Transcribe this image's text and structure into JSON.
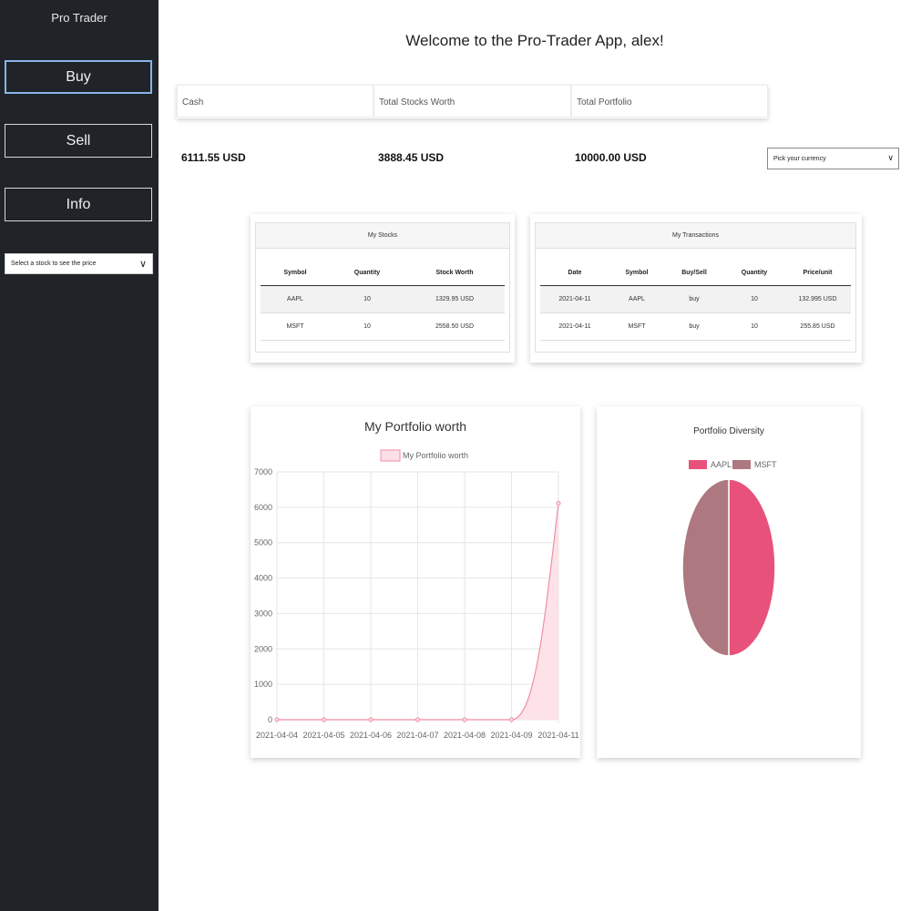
{
  "sidebar": {
    "brand": "Pro Trader",
    "buttons": [
      {
        "label": "Buy"
      },
      {
        "label": "Sell"
      },
      {
        "label": "Info"
      }
    ],
    "stock_select": {
      "value": "Select a stock to see the price"
    }
  },
  "header": {
    "title": "Welcome to the Pro-Trader App, alex!"
  },
  "summary": {
    "cash_label": "Cash",
    "stocks_label": "Total Stocks Worth",
    "portfolio_label": "Total Portfolio",
    "cash_value": "6111.55 USD",
    "stocks_value": "3888.45 USD",
    "portfolio_value": "10000.00 USD"
  },
  "currency_select": {
    "value": "Pick your currency"
  },
  "my_stocks": {
    "title": "My Stocks",
    "columns": [
      "Symbol",
      "Quantity",
      "Stock Worth"
    ],
    "rows": [
      [
        "AAPL",
        "10",
        "1329.95 USD"
      ],
      [
        "MSFT",
        "10",
        "2558.50 USD"
      ]
    ]
  },
  "my_transactions": {
    "title": "My Transactions",
    "columns": [
      "Date",
      "Symbol",
      "Buy/Sell",
      "Quantity",
      "Price/unit"
    ],
    "rows": [
      [
        "2021-04-11",
        "AAPL",
        "buy",
        "10",
        "132.995 USD"
      ],
      [
        "2021-04-11",
        "MSFT",
        "buy",
        "10",
        "255.85 USD"
      ]
    ]
  },
  "chart_data": [
    {
      "type": "area",
      "title": "My Portfolio worth",
      "series": [
        {
          "name": "My Portfolio worth",
          "x": [
            "2021-04-04",
            "2021-04-05",
            "2021-04-06",
            "2021-04-07",
            "2021-04-08",
            "2021-04-09",
            "2021-04-11"
          ],
          "values": [
            0,
            0,
            0,
            0,
            0,
            0,
            6111.55
          ]
        }
      ],
      "ylim": [
        0,
        7000
      ],
      "yticks": [
        0,
        1000,
        2000,
        3000,
        4000,
        5000,
        6000,
        7000
      ],
      "grid": true,
      "legend": "top",
      "colors": {
        "line": "#f08ea5",
        "fill": "#fde0e6"
      }
    },
    {
      "type": "pie",
      "title": "Portfolio Diversity",
      "categories": [
        "AAPL",
        "MSFT"
      ],
      "values": [
        50,
        50
      ],
      "legend": "top",
      "colors": [
        "#e8527a",
        "#ad7880"
      ]
    }
  ]
}
